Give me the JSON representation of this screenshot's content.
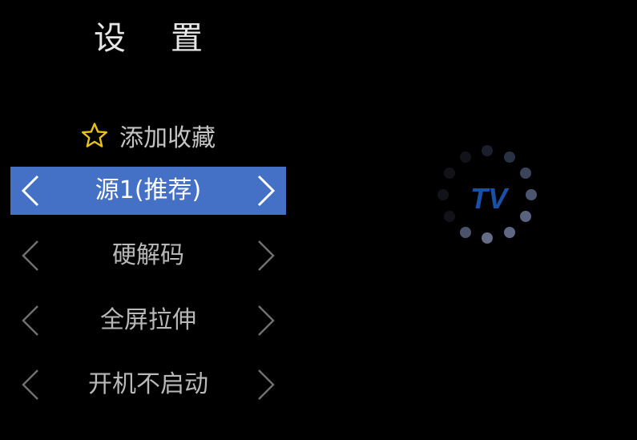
{
  "header": {
    "title": "设置"
  },
  "favorite": {
    "label": "添加收藏",
    "icon": "star-icon",
    "star_color": "#e8c21c"
  },
  "options": [
    {
      "key": "source",
      "label": "源1(推荐)",
      "selected": true
    },
    {
      "key": "decoder",
      "label": "硬解码",
      "selected": false
    },
    {
      "key": "aspect",
      "label": "全屏拉伸",
      "selected": false
    },
    {
      "key": "autostart",
      "label": "开机不启动",
      "selected": false
    }
  ],
  "colors": {
    "background": "#000000",
    "selected_row": "#4470c5",
    "loader_logo": "#1a4fa8"
  },
  "loader": {
    "logo_text": "TV",
    "icon": "loading-spinner-icon"
  }
}
